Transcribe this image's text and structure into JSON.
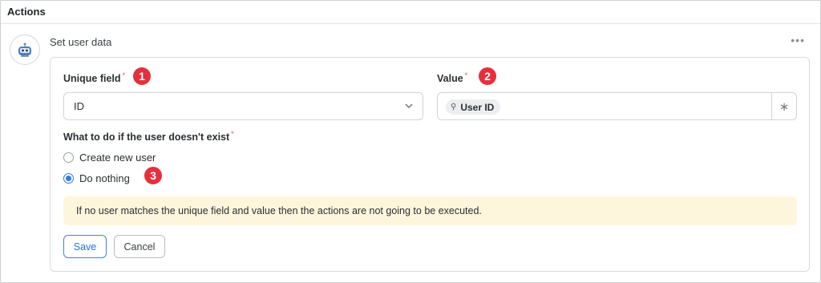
{
  "header": {
    "title": "Actions"
  },
  "step": {
    "title": "Set user data",
    "more_icon": "ellipsis-icon",
    "avatar_icon": "robot-icon"
  },
  "form": {
    "unique_field": {
      "label": "Unique field",
      "required_mark": "*",
      "value": "ID",
      "badge": "1"
    },
    "value_field": {
      "label": "Value",
      "required_mark": "*",
      "chip_label": "User ID",
      "chip_icon": "variable-icon",
      "badge": "2",
      "asterisk_symbol": "∗"
    },
    "missing_user": {
      "label": "What to do if the user doesn't exist",
      "required_mark": "*",
      "options": [
        {
          "label": "Create new user",
          "selected": false
        },
        {
          "label": "Do nothing",
          "selected": true
        }
      ],
      "badge": "3"
    },
    "note": "If no user matches the unique field and value then the actions are not going to be executed.",
    "save_label": "Save",
    "cancel_label": "Cancel"
  },
  "colors": {
    "accent": "#2b7de9",
    "badge": "#e5303b",
    "note_bg": "#fdf6dd",
    "required": "#e5484d"
  }
}
